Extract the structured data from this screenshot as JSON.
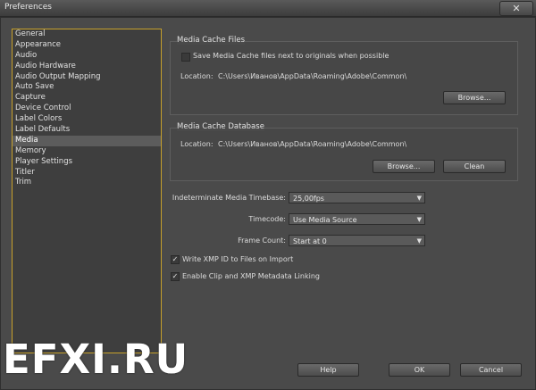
{
  "window": {
    "title": "Preferences",
    "close_glyph": "✕"
  },
  "sidebar": {
    "items": [
      {
        "label": "General"
      },
      {
        "label": "Appearance"
      },
      {
        "label": "Audio"
      },
      {
        "label": "Audio Hardware"
      },
      {
        "label": "Audio Output Mapping"
      },
      {
        "label": "Auto Save"
      },
      {
        "label": "Capture"
      },
      {
        "label": "Device Control"
      },
      {
        "label": "Label Colors"
      },
      {
        "label": "Label Defaults"
      },
      {
        "label": "Media",
        "selected": true
      },
      {
        "label": "Memory"
      },
      {
        "label": "Player Settings"
      },
      {
        "label": "Titler"
      },
      {
        "label": "Trim"
      }
    ]
  },
  "media_cache_files": {
    "title": "Media Cache Files",
    "checkbox_label": "Save Media Cache files next to originals when possible",
    "checked": false,
    "location_label": "Location:",
    "location_value": "C:\\Users\\Иванов\\AppData\\Roaming\\Adobe\\Common\\",
    "browse_label": "Browse..."
  },
  "media_cache_db": {
    "title": "Media Cache Database",
    "location_label": "Location:",
    "location_value": "C:\\Users\\Иванов\\AppData\\Roaming\\Adobe\\Common\\",
    "browse_label": "Browse...",
    "clean_label": "Clean"
  },
  "settings": {
    "timebase_label": "Indeterminate Media Timebase:",
    "timebase_value": "25,00fps",
    "timecode_label": "Timecode:",
    "timecode_value": "Use Media Source",
    "framecount_label": "Frame Count:",
    "framecount_value": "Start at 0",
    "xmp_label": "Write XMP ID to Files on Import",
    "xmp_checked": true,
    "linking_label": "Enable Clip and XMP Metadata Linking",
    "linking_checked": true,
    "check_glyph": "✓",
    "arrow_glyph": "▼"
  },
  "footer": {
    "help_label": "Help",
    "ok_label": "OK",
    "cancel_label": "Cancel"
  },
  "watermark": "EFXI.RU"
}
